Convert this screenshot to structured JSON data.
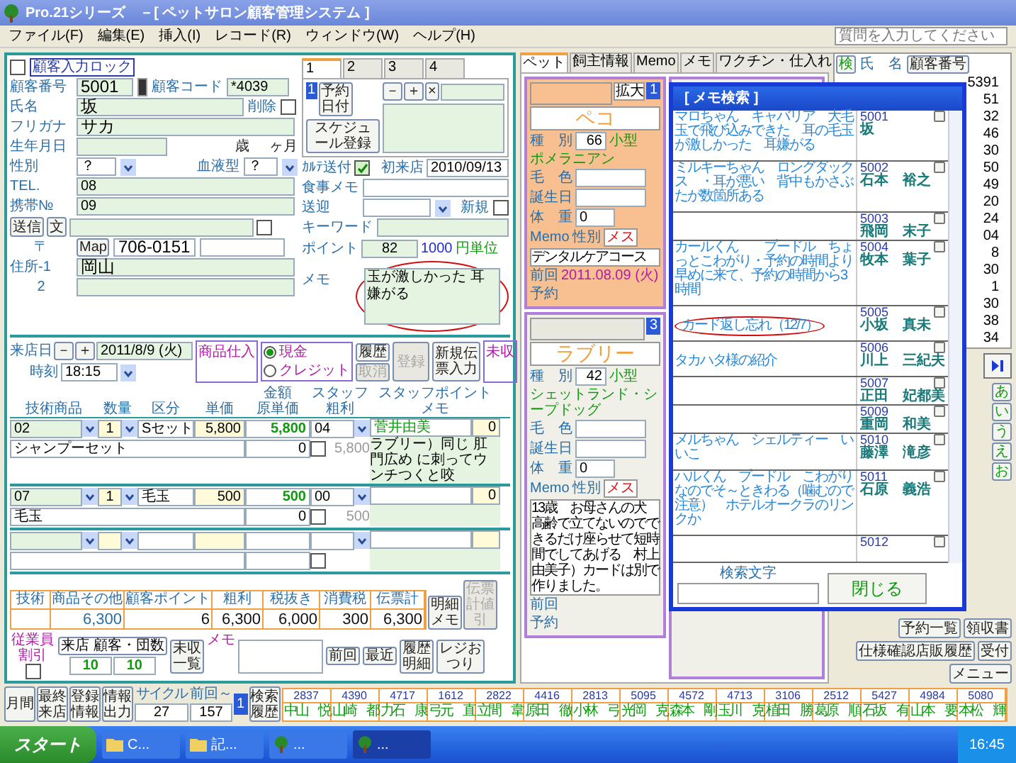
{
  "window": {
    "title": "Pro.21シリーズ　－[ ペットサロン顧客管理システム ]",
    "help_placeholder": "質問を入力してください"
  },
  "menu": [
    "ファイル(F)",
    "編集(E)",
    "挿入(I)",
    "レコード(R)",
    "ウィンドウ(W)",
    "ヘルプ(H)"
  ],
  "customer": {
    "lock": {
      "label": "顧客入力ロック",
      "checked": false
    },
    "number": {
      "label": "顧客番号",
      "value": "5001"
    },
    "code": {
      "label": "顧客コード",
      "value": "*4039"
    },
    "name": {
      "label": "氏名",
      "value": "坂"
    },
    "delete": {
      "label": "削除",
      "checked": false
    },
    "kana": {
      "label": "フリガナ",
      "value": "サカ"
    },
    "birth": {
      "label": "生年月日",
      "age_unit": "歳",
      "month_unit": "ヶ月"
    },
    "sex": {
      "label": "性別",
      "value": "？"
    },
    "blood": {
      "label": "血液型",
      "value": "？"
    },
    "tel": {
      "label": "TEL.",
      "value": "08"
    },
    "mobile": {
      "label": "携帯№",
      "value": "09"
    },
    "send_buttons": [
      "送信",
      "文"
    ],
    "send_checked": false,
    "zip": {
      "label": "〒",
      "map": "Map",
      "value": "706-0151"
    },
    "addr1": {
      "label": "住所-1",
      "value": "岡山"
    },
    "addr2": {
      "label": "2"
    }
  },
  "schedule": {
    "tabs": [
      {
        "label": "1",
        "selected": true
      },
      {
        "label": "2",
        "selected": false
      },
      {
        "label": "3",
        "selected": false
      },
      {
        "label": "4",
        "selected": false
      }
    ],
    "slot": "1",
    "reserve": "予約日付",
    "small_buttons": [
      "－",
      "＋",
      "×"
    ],
    "register": "スケジュール登録"
  },
  "info": {
    "karte": {
      "label": "ｶﾙﾃ送付",
      "checked": true
    },
    "first_visit": {
      "label": "初来店",
      "value": "2010/09/13"
    },
    "meal": {
      "label": "食事メモ"
    },
    "pickup": {
      "label": "送迎"
    },
    "new": {
      "label": "新規",
      "checked": false
    },
    "keyword": {
      "label": "キーワード"
    },
    "point": {
      "label": "ポイント",
      "value": "82",
      "unit_value": "1000",
      "unit": "円単位"
    },
    "memo": {
      "label": "メモ",
      "value": "玉が激しかった 耳嫌がる",
      "circled": true
    }
  },
  "visit": {
    "date_label": "来店日",
    "step_buttons": [
      "－",
      "＋"
    ],
    "date": "2011/8/9 (火)",
    "time_label": "時刻",
    "time": "18:15",
    "purchase": "商品仕入",
    "payments": [
      {
        "label": "現金",
        "selected": true
      },
      {
        "label": "クレジット",
        "selected": false
      }
    ],
    "history": "履歴",
    "cancel": {
      "label": "取消",
      "disabled": true
    },
    "register": {
      "label": "登録",
      "disabled": true
    },
    "new_slip": "新規伝票入力",
    "unpaid": "未収"
  },
  "table": {
    "columns": [
      {
        "top": "技術商品"
      },
      {
        "top": "数量"
      },
      {
        "top": "区分"
      },
      {
        "top": "単価"
      },
      {
        "top": "金額",
        "bottom": "原単価"
      },
      {
        "top": "スタッフ",
        "bottom": "粗利"
      },
      {
        "top": "スタッフポイント",
        "bottom": "メモ"
      }
    ],
    "rows": [
      {
        "code": "02",
        "qty": "1",
        "category": "Sセット",
        "price": "5,800",
        "amount": "5,800",
        "staff": "04",
        "staff_name": "菅井由美",
        "staff_point": "0",
        "item": "シャンプーセット",
        "cost": "0",
        "cost_checked": false,
        "profit": "5,800",
        "memo": "ラブリー）同じ 肛門広め に刺ってウンチつくと咬"
      },
      {
        "code": "07",
        "qty": "1",
        "category": "毛玉",
        "price": "500",
        "amount": "500",
        "staff": "00",
        "staff_point": "0",
        "item": "毛玉",
        "cost": "0",
        "cost_checked": false,
        "profit": "500"
      },
      {
        "cost_checked": false
      }
    ]
  },
  "totals": [
    {
      "label": "技術"
    },
    {
      "label": "商品その他",
      "value": "6,300"
    },
    {
      "label": "顧客ポイント",
      "value": "6"
    },
    {
      "label": "粗利",
      "value": "6,300"
    },
    {
      "label": "税抜き",
      "value": "6,000"
    },
    {
      "label": "消費税",
      "value": "300"
    },
    {
      "label": "伝票計",
      "value": "6,300"
    }
  ],
  "total_buttons": [
    {
      "label": "明細メモ",
      "disabled": false
    },
    {
      "label": "伝票計値引",
      "disabled": true
    }
  ],
  "footer": {
    "staff_discount": {
      "label": "従業員割引",
      "checked": false
    },
    "visits_label": "来店 顧客・団数",
    "visits": [
      "10",
      "10"
    ],
    "unpaid_list": "未収一覧",
    "memo_label": "メモ",
    "buttons": [
      "前回",
      "最近",
      "履歴明細",
      "レジおつり"
    ]
  },
  "lower_buttons": [
    "月間",
    "最終来店",
    "登録情報",
    "情報出力"
  ],
  "cycle": {
    "label": "サイクル",
    "value": "27"
  },
  "since": {
    "label": "前回～",
    "value": "157"
  },
  "cycle_slot": "1",
  "search_history": "検索履歴",
  "recent": [
    {
      "no": "2837",
      "name": "中山　悦"
    },
    {
      "no": "4390",
      "name": "山崎　都"
    },
    {
      "no": "4717",
      "name": "力石　康"
    },
    {
      "no": "1612",
      "name": "弓元　直"
    },
    {
      "no": "2822",
      "name": "立間　韋"
    },
    {
      "no": "4416",
      "name": "原田　徹"
    },
    {
      "no": "2813",
      "name": "小林　弓"
    },
    {
      "no": "5095",
      "name": "光岡　克"
    },
    {
      "no": "4572",
      "name": "森本　剛"
    },
    {
      "no": "4713",
      "name": "玉川　克"
    },
    {
      "no": "3106",
      "name": "植田　勝"
    },
    {
      "no": "2512",
      "name": "葛原　順"
    },
    {
      "no": "5427",
      "name": "石坂　有"
    },
    {
      "no": "4984",
      "name": "山本　要"
    },
    {
      "no": "5080",
      "name": "本松　輝"
    }
  ],
  "pet_tabs": [
    {
      "label": "ペット",
      "selected": true
    },
    {
      "label": "飼主情報",
      "selected": false
    },
    {
      "label": "Memo",
      "selected": false
    },
    {
      "label": "メモ",
      "selected": false
    },
    {
      "label": "ワクチン・仕入れ",
      "selected": false
    }
  ],
  "pets": [
    {
      "slot": "1",
      "zoom": "拡大",
      "name": "ペコ",
      "highlighted": true,
      "code": "66",
      "size": "小型",
      "breed": "ポメラニアン",
      "weight": "0",
      "sex": "メス",
      "memo": "デンタルケアコース",
      "last_label": "前回",
      "last": "2011.08.09 (火)",
      "reserve": "予約",
      "labels": {
        "kind": "種　別",
        "hair": "毛　色",
        "birth": "誕生日",
        "weight": "体　重",
        "memo": "Memo",
        "sex": "性別"
      }
    },
    {
      "slot": "3",
      "name": "ラブリー",
      "highlighted": false,
      "code": "42",
      "size": "小型",
      "breed": "シェットランド・シープドッグ",
      "weight": "0",
      "sex": "メス",
      "memo": "13歳　お母さんの犬高齢で立てないのでできるだけ座らせて短時間でしてあげる　村上由美子）カードは別で作りました。",
      "last_label": "前回",
      "reserve": "予約",
      "labels": {
        "kind": "種　別",
        "hair": "毛　色",
        "birth": "誕生日",
        "weight": "体　重",
        "memo": "Memo",
        "sex": "性別"
      }
    }
  ],
  "list": {
    "search_button": "検",
    "name_header": "氏　名",
    "number_header": "顧客番号",
    "numbers": [
      "5391",
      "51",
      "32",
      "46",
      "30",
      "50",
      "49",
      "20",
      "24",
      "04",
      "8",
      "30",
      "1",
      "30",
      "38",
      "34"
    ],
    "kana": [
      "あ",
      "い",
      "う",
      "え",
      "お"
    ],
    "buttons": [
      "予約一覧",
      "領収書",
      "仕様確認店販履歴",
      "受付",
      "メニュー"
    ]
  },
  "dialog": {
    "title": "[ メモ検索 ]",
    "entries": [
      {
        "memo": "マロちゃん　キャバリア　大毛玉で飛び込みできた　耳の毛玉が激しかった　耳嫌がる",
        "no": "5001",
        "name": "坂",
        "circled": false
      },
      {
        "memo": "ミルキーちゃん　ロングダックス　・耳が悪い　背中もかさぶたが数箇所ある",
        "no": "5002",
        "name": "石本　裕之",
        "circled": false
      },
      {
        "no": "5003",
        "name": "飛岡　末子",
        "circled": false
      },
      {
        "memo": "カールくん　　プードル　ちょっとこわがり・予約の時間より早めに来て、予約の時間から3時間",
        "no": "5004",
        "name": "牧本　葉子",
        "circled": false
      },
      {
        "memo": "カード返し忘れ（12/7）",
        "no": "5005",
        "name": "小坂　真未",
        "circled": true
      },
      {
        "memo": "タカハタ様の紹介",
        "no": "5006",
        "name": "川上　三紀夫",
        "circled": false
      },
      {
        "no": "5007",
        "name": "正田　妃都美",
        "circled": false
      },
      {
        "no": "5009",
        "name": "重岡　和美",
        "circled": false
      },
      {
        "memo": "メルちゃん　シェルティー　いいこ",
        "no": "5010",
        "name": "藤澤　滝彦",
        "circled": false
      },
      {
        "memo": "ハルくん　プードル　こわがりなのでそ～ときわる（噛むので注意）　ホテルオークラのリンクか",
        "no": "5011",
        "name": "石原　義浩",
        "circled": false
      },
      {
        "no": "5012",
        "circled": false
      }
    ],
    "search_label": "検索文字",
    "close": "閉じる"
  },
  "taskbar": {
    "start": "スタート",
    "tasks": [
      {
        "label": "C...",
        "selected": false,
        "kind": "folder"
      },
      {
        "label": "記...",
        "selected": false,
        "kind": "folder"
      },
      {
        "label": "...",
        "selected": false,
        "kind": "app"
      },
      {
        "label": "...",
        "selected": true,
        "kind": "app"
      }
    ],
    "time": "16:45"
  }
}
